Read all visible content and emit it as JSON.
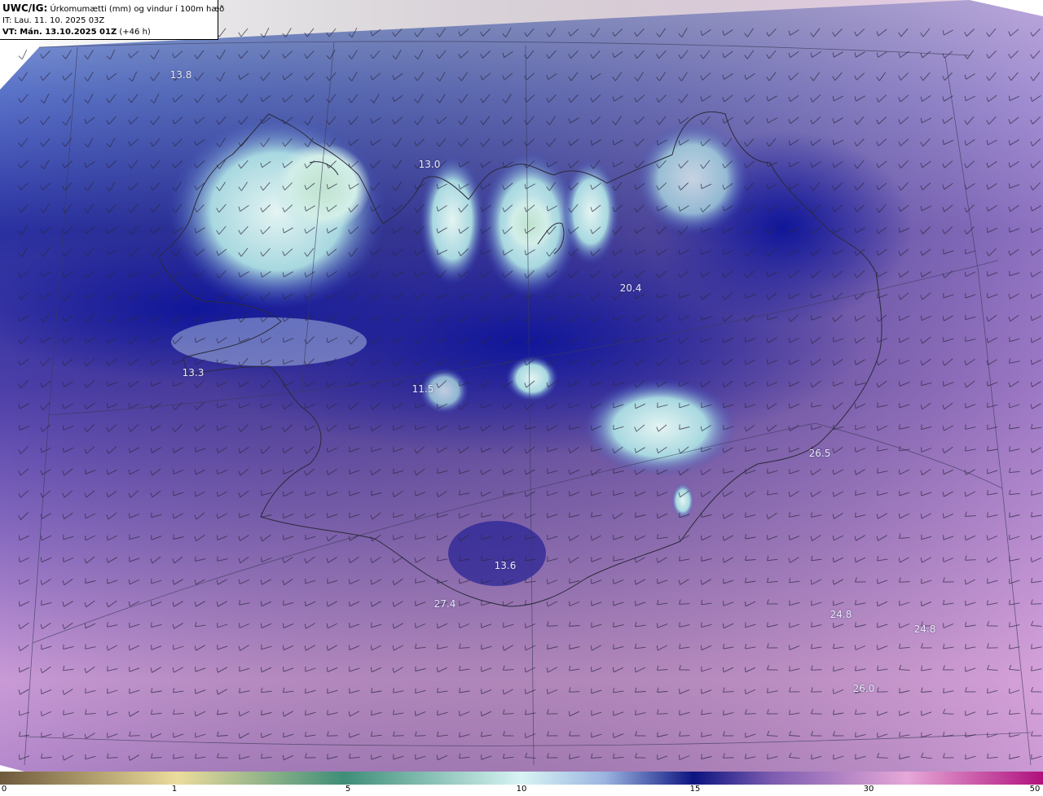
{
  "info": {
    "product": "UWC/IG:",
    "title": "Úrkomumætti (mm) og vindur í 100m hæð",
    "issue_time": "IT: Lau. 11. 10. 2025 03Z",
    "valid_prefix": "VT:",
    "valid_time": "Mán. 13.10.2025 01Z",
    "lead": "(+46 h)"
  },
  "map_labels": [
    {
      "text": "13.8"
    },
    {
      "text": "13.0"
    },
    {
      "text": "20.4"
    },
    {
      "text": "13.3"
    },
    {
      "text": "11.5"
    },
    {
      "text": "26.5"
    },
    {
      "text": "13.6"
    },
    {
      "text": "27.4"
    },
    {
      "text": "24.8"
    },
    {
      "text": "24.8"
    },
    {
      "text": "26.0"
    }
  ],
  "colorbar": {
    "ticks": [
      "0",
      "1",
      "5",
      "10",
      "15",
      "30",
      "50"
    ],
    "colors": {
      "brown": "#6e5a3c",
      "yellow": "#ecdc9c",
      "green": "#3e8e78",
      "lightcyan": "#d8f4f4",
      "lightblue": "#9ab4e0",
      "navy": "#0c1480",
      "purple": "#7c5cb0",
      "pink": "#e6a8d8",
      "magenta": "#b0107c"
    }
  }
}
